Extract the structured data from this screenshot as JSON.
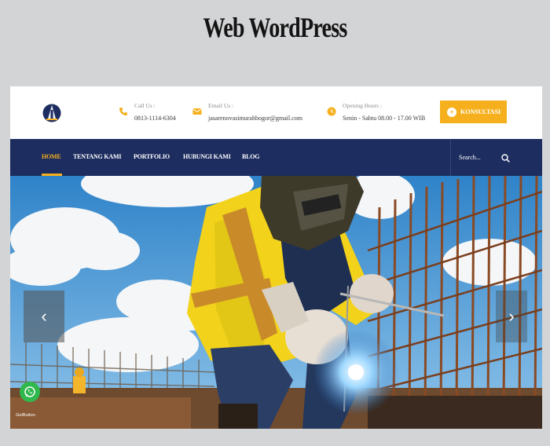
{
  "page_title": "Web WordPress",
  "header": {
    "call": {
      "label": "Call Us :",
      "value": "0813-1114-6304",
      "icon": "phone-icon"
    },
    "email": {
      "label": "Email Us :",
      "value": "jasarenovasimurahbogor@gmail.com",
      "icon": "envelope-icon"
    },
    "hours": {
      "label": "Opening Hours :",
      "value": "Senin - Sabtu 08.00 - 17.00 WIB",
      "icon": "clock-icon"
    },
    "cta_label": "KONSULTASI"
  },
  "nav": {
    "items": [
      "HOME",
      "TENTANG KAMI",
      "PORTFOLIO",
      "HUBUNGI KAMI",
      "BLOG"
    ],
    "search_placeholder": "Search..."
  },
  "hero": {
    "prev_symbol": "‹",
    "next_symbol": "›",
    "whatsapp_caption": "GetButton"
  },
  "colors": {
    "accent": "#f6b01e",
    "nav_bg": "#1d2d5f",
    "whatsapp": "#2fb84d"
  }
}
